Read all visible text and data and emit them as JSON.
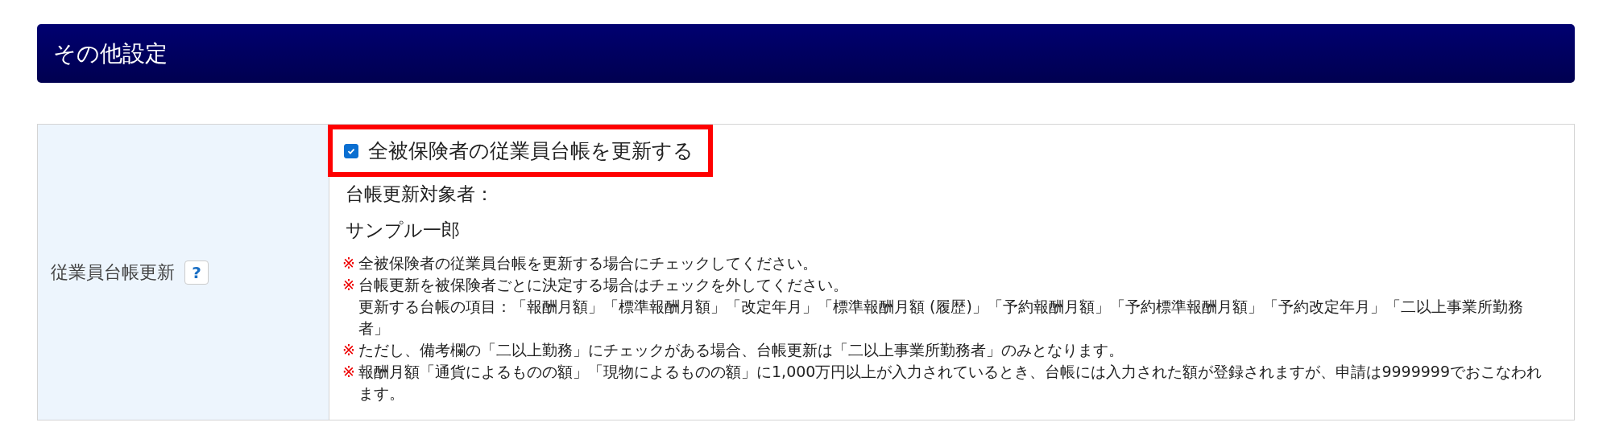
{
  "section": {
    "title": "その他設定"
  },
  "row": {
    "label": "従業員台帳更新",
    "help": "?",
    "checkbox": {
      "label": "全被保険者の従業員台帳を更新する",
      "checked": true,
      "highlighted": true
    },
    "targets_label": "台帳更新対象者：",
    "targets": [
      "サンプル一郎"
    ],
    "notes": [
      {
        "mark": "※",
        "text": "全被保険者の従業員台帳を更新する場合にチェックしてください。"
      },
      {
        "mark": "※",
        "text": "台帳更新を被保険者ごとに決定する場合はチェックを外してください。",
        "detail": "更新する台帳の項目：「報酬月額」「標準報酬月額」「改定年月」「標準報酬月額 (履歴)」「予約報酬月額」「予約標準報酬月額」「予約改定年月」「二以上事業所勤務者」"
      },
      {
        "mark": "※",
        "text": "ただし、備考欄の「二以上勤務」にチェックがある場合、台帳更新は「二以上事業所勤務者」のみとなります。"
      },
      {
        "mark": "※",
        "text": "報酬月額「通貨によるものの額」「現物によるものの額」に1,000万円以上が入力されているとき、台帳には入力された額が登録されますが、申請は9999999でおこなわれます。"
      }
    ]
  }
}
